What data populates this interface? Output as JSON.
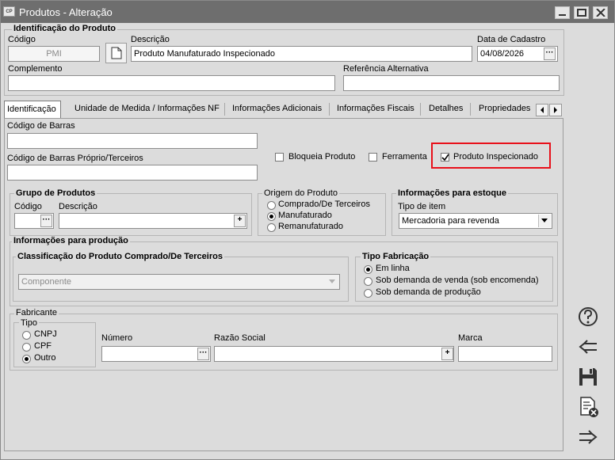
{
  "window": {
    "title": "Produtos - Alteração",
    "icon_text": "CP"
  },
  "identificacao": {
    "group_label": "Identificação do Produto",
    "codigo_label": "Código",
    "codigo_value": "PMI",
    "descricao_label": "Descrição",
    "descricao_value": "Produto Manufaturado Inspecionado",
    "data_label": "Data de Cadastro",
    "data_value": "04/08/2026",
    "complemento_label": "Complemento",
    "complemento_value": "",
    "referencia_label": "Referência Alternativa",
    "referencia_value": ""
  },
  "tabs": [
    {
      "label": "Identificação"
    },
    {
      "label": "Unidade de Medida / Informações NF"
    },
    {
      "label": "Informações Adicionais"
    },
    {
      "label": "Informações Fiscais"
    },
    {
      "label": "Detalhes"
    },
    {
      "label": "Propriedades"
    }
  ],
  "panel": {
    "barras_label": "Código de Barras",
    "barras_proprio_label": "Código de Barras Próprio/Terceiros",
    "bloqueia_label": "Bloqueia Produto",
    "bloqueia_checked": false,
    "ferramenta_label": "Ferramenta",
    "ferramenta_checked": false,
    "inspecionado_label": "Produto Inspecionado",
    "inspecionado_checked": true,
    "highlight_color": "#e8101a"
  },
  "grupo": {
    "label": "Grupo de Produtos",
    "codigo_label": "Código",
    "descricao_label": "Descrição"
  },
  "origem": {
    "label": "Origem do Produto",
    "options": [
      "Comprado/De Terceiros",
      "Manufaturado",
      "Remanufaturado"
    ],
    "selected": "Manufaturado"
  },
  "estoque": {
    "label": "Informações para estoque",
    "tipo_label": "Tipo de item",
    "tipo_value": "Mercadoria para revenda"
  },
  "producao": {
    "label": "Informações para produção",
    "classificacao_label": "Classificação do Produto Comprado/De Terceiros",
    "classificacao_value": "Componente",
    "fabricacao_label": "Tipo Fabricação",
    "fabricacao_options": [
      "Em linha",
      "Sob demanda de venda (sob encomenda)",
      "Sob demanda de produção"
    ],
    "fabricacao_selected": "Em linha"
  },
  "fabricante": {
    "label": "Fabricante",
    "tipo_label": "Tipo",
    "tipo_options": [
      "CNPJ",
      "CPF",
      "Outro"
    ],
    "tipo_selected": "Outro",
    "numero_label": "Número",
    "razao_label": "Razão Social",
    "marca_label": "Marca"
  },
  "sidebar": [
    "help-icon",
    "back-arrow-icon",
    "save-icon",
    "delete-document-icon",
    "next-arrow-icon"
  ]
}
